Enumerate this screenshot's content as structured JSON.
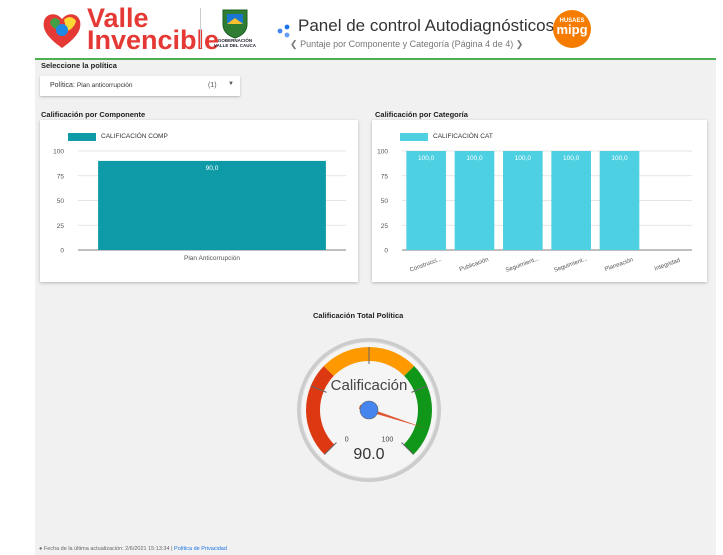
{
  "header": {
    "brand_line1": "Valle",
    "brand_line2": "Invencible",
    "gov_label_line1": "GOBERNACIÓN",
    "gov_label_line2": "VALLE DEL CAUCA",
    "title": "Panel de control Autodiagnósticos",
    "page_indicator": "Puntaje por Componente y Categoría (Página 4 de 4)",
    "prev_icon": "chevron-left-icon",
    "next_icon": "chevron-right-icon",
    "mipg_line1": "HUSAES",
    "mipg_line2": "mipg",
    "colors": {
      "brand_red": "#e53935",
      "accent_green": "#4caf50",
      "mipg_orange": "#f57c00"
    }
  },
  "filter": {
    "section_label": "Seleccione la política",
    "field_label": "Política:",
    "field_value": "Plan anticorrupción",
    "count": "(1)",
    "arrow_icon": "dropdown-arrow-icon"
  },
  "component_chart": {
    "section_label": "Calificación por Componente",
    "legend": "CALIFICACIÓN COMP",
    "color": "#0e9aa7"
  },
  "category_chart": {
    "section_label": "Calificación por Categoría",
    "legend": "CALIFICACIÓN CAT",
    "color": "#4dd0e1"
  },
  "gauge": {
    "section_label": "Calificación Total Política",
    "label": "Calificación",
    "min_label": "0",
    "max_label": "100",
    "value_label": "90.0",
    "value": 90,
    "min": 0,
    "max": 100,
    "colors": {
      "red": "#dc3912",
      "orange": "#ff9900",
      "green": "#109618",
      "needle": "#dc3912",
      "hub": "#4684ee"
    }
  },
  "footer": {
    "updated": "Fecha de la última actualización: 2/6/2021 15:13:34",
    "separator": "|",
    "privacy": "Política de Privacidad"
  },
  "chart_data": [
    {
      "type": "bar",
      "categories": [
        "Plan Anticorrupción"
      ],
      "series": [
        {
          "name": "CALIFICACIÓN COMP",
          "values": [
            90.0
          ]
        }
      ],
      "data_labels": [
        "90,0"
      ],
      "ylim": [
        0,
        100
      ],
      "yticks": [
        0,
        25,
        50,
        75,
        100
      ],
      "grid": true,
      "legend": "top-left"
    },
    {
      "type": "bar",
      "categories": [
        "Construcci...",
        "Publicación",
        "Seguimient...",
        "Seguimient...",
        "Planeación",
        "Integridad"
      ],
      "series": [
        {
          "name": "CALIFICACIÓN CAT",
          "values": [
            100.0,
            100.0,
            100.0,
            100.0,
            100.0,
            null
          ]
        }
      ],
      "data_labels": [
        "100,0",
        "100,0",
        "100,0",
        "100,0",
        "100,0",
        ""
      ],
      "ylim": [
        0,
        100
      ],
      "yticks": [
        0,
        25,
        50,
        75,
        100
      ],
      "grid": true,
      "legend": "top-left"
    }
  ]
}
